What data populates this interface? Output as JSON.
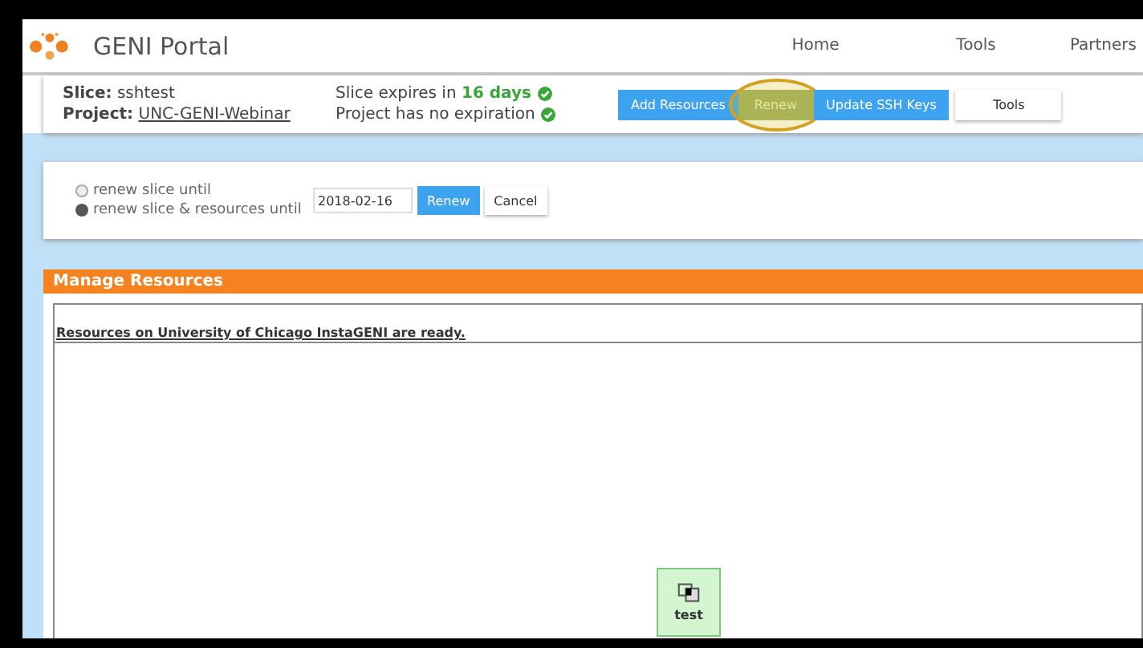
{
  "header": {
    "title": "GENI Portal",
    "nav": [
      {
        "label": "Home"
      },
      {
        "label": "Tools"
      },
      {
        "label": "Partners"
      }
    ]
  },
  "slice": {
    "slice_label": "Slice:",
    "slice_name": "sshtest",
    "project_label": "Project:",
    "project_name": "UNC-GENI-Webinar",
    "expiry_prefix": "Slice expires in",
    "expiry_value": "16 days",
    "expiry_ok": true,
    "project_expiry": "Project has no expiration",
    "project_ok": true
  },
  "actions": [
    {
      "label": "Add Resources",
      "kind": "primary",
      "highlighted": false
    },
    {
      "label": "Renew",
      "kind": "active",
      "highlighted": true
    },
    {
      "label": "Update SSH Keys",
      "kind": "primary",
      "highlighted": false
    },
    {
      "label": "Tools",
      "kind": "plain",
      "highlighted": false
    }
  ],
  "renew_form": {
    "options": [
      {
        "label": "renew slice until",
        "selected": false
      },
      {
        "label": "renew slice & resources until",
        "selected": true
      }
    ],
    "date": "2018-02-16",
    "buttons": [
      {
        "label": "Renew",
        "kind": "primary"
      },
      {
        "label": "Cancel",
        "kind": "plain"
      }
    ]
  },
  "manage": {
    "title": "Manage Resources",
    "status": "Resources on University of Chicago InstaGENI are ready.",
    "nodes": [
      {
        "label": "test"
      }
    ]
  }
}
